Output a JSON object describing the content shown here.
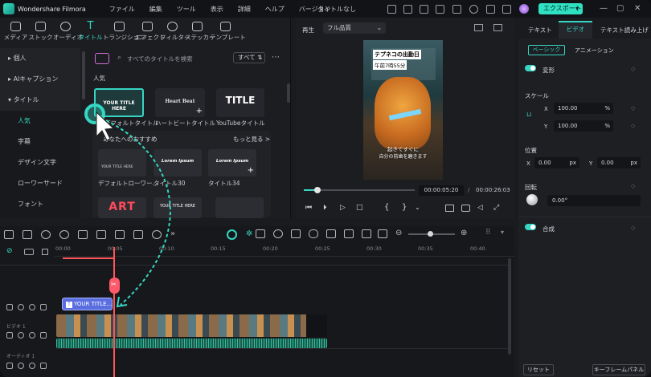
{
  "app": {
    "name": "Wondershare Filmora",
    "doc_title": "タイトルなし",
    "export_label": "エクスポート"
  },
  "menu": [
    "ファイル",
    "編集",
    "ツール",
    "表示",
    "詳細",
    "ヘルプ",
    "バージョン"
  ],
  "media_tabs": [
    "メディア",
    "ストック",
    "オーディオ",
    "タイトル",
    "トランジション",
    "エフェクト",
    "フィルター",
    "ステッカー",
    "テンプレート"
  ],
  "active_media_tab": "タイトル",
  "categories": [
    {
      "label": "個人",
      "type": "head"
    },
    {
      "label": "AIキャプション",
      "type": "head"
    },
    {
      "label": "タイトル",
      "type": "head"
    },
    {
      "label": "人気",
      "type": "sub-selected"
    },
    {
      "label": "字幕",
      "type": "sub"
    },
    {
      "label": "デザイン文字",
      "type": "sub"
    },
    {
      "label": "ローワーサード",
      "type": "sub"
    },
    {
      "label": "フォント",
      "type": "sub"
    }
  ],
  "search": {
    "placeholder": "すべてのタイトルを検索",
    "filter": "すべて"
  },
  "section_popular": "人気",
  "popular_items": [
    {
      "thumb_text": "YOUR TITLE HERE",
      "label": "デフォルトタイトル"
    },
    {
      "thumb_text": "Heart Beat",
      "label": "ハートビートタイトル"
    },
    {
      "thumb_text": "TITLE",
      "label": "YouTubeタイトル"
    }
  ],
  "recommend": {
    "label": "あなたへのおすすめ",
    "more": "もっと見る >"
  },
  "recommend_items": [
    {
      "thumb_text": "YOUR TITLE HERE",
      "label": "デフォルトローワー..."
    },
    {
      "thumb_text": "Lorem Ipsum",
      "label": "タイトル30"
    },
    {
      "thumb_text": "Lorem Ipsum",
      "label": "タイトル34"
    }
  ],
  "row3_items": [
    {
      "thumb_text": "ART"
    },
    {
      "thumb_text": "YOUR TITLE HERE"
    },
    {
      "thumb_text": ""
    }
  ],
  "preview": {
    "play_label": "再生",
    "quality": "フル品質",
    "caption_top": "テプネコの出勤日",
    "caption_time": "午前7時55分",
    "caption_bottom1": "起きてすぐに",
    "caption_bottom2": "自分の前歯を磨きます",
    "current_time": "00:00:05:20",
    "separator": "/",
    "total_time": "00:00:26:03",
    "progress": 0.12
  },
  "right_tabs": [
    "テキスト",
    "ビデオ",
    "テキスト読み上げ"
  ],
  "active_right_tab": "ビデオ",
  "subtabs": [
    "ベーシック",
    "アニメーション"
  ],
  "transform": {
    "label": "変形",
    "scale_label": "スケール",
    "x": "100.00",
    "y": "100.00",
    "unit": "%",
    "position_label": "位置",
    "px": "0.00",
    "py": "0.00",
    "punit": "px",
    "rotate_label": "回転",
    "rotate": "0.00°"
  },
  "composite_label": "合成",
  "footer": {
    "reset": "リセット",
    "keyframe": "キーフレームパネル"
  },
  "timeline": {
    "ticks": [
      "00:00",
      "00:05",
      "00:10",
      "00:15",
      "00:20",
      "00:25",
      "00:30",
      "00:35",
      "00:40"
    ],
    "title_clip": "YOUR TITLE...",
    "video_track": "ビデオ 1",
    "audio_track": "オーディオ 1"
  },
  "colors": {
    "accent": "#35d6c3",
    "playhead": "#ff5555",
    "export": "#2fe0c2",
    "clip_title": "#5a6ee0",
    "audio_wave": "#2fbf9e"
  }
}
